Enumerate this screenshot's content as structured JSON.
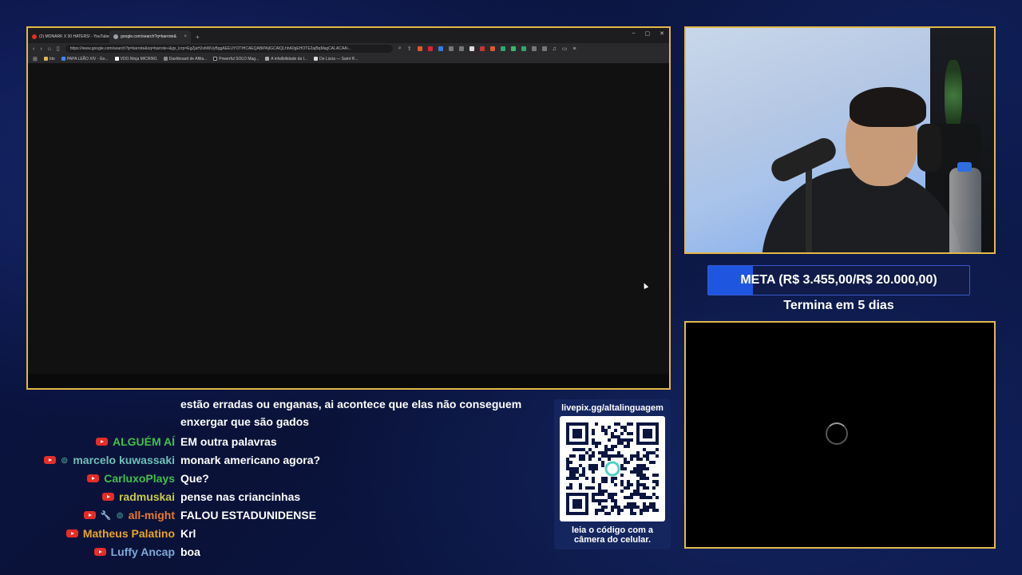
{
  "browser": {
    "tabs": [
      {
        "label": "(2) MONARK X 30 HATERS! - YouTube",
        "favicon_color": "#e52d27",
        "active": false
      },
      {
        "label": "google.com/search?q=barrote&",
        "favicon_color": "#9aa0a6",
        "active": true
      }
    ],
    "new_tab_symbol": "+",
    "window_controls": [
      "–",
      "▢",
      "✕"
    ],
    "url": "https://www.google.com/search?q=barrote&oq=barrote+&gs_lcrp=EgZjaHJvbWUyBggAEEUYOTIHCAEQABiPAjIGCAIQLhhA0gEHOTE2ajBqMagCALACAAi...",
    "bookmarks": [
      {
        "label": "Ide",
        "color": "#e2b84a"
      },
      {
        "label": "PAPA LEÃO XIV - Go...",
        "color": "#e2b84a"
      },
      {
        "label": "VDO.Ninja MICRIM1",
        "color": "#ffffff"
      },
      {
        "label": "Dashboard de Afilia...",
        "color": "#888888"
      },
      {
        "label": "Powerful SOLO Mag...",
        "color": "#e2582a"
      },
      {
        "label": "A infalibilidade da I...",
        "color": "#aaaaaa"
      },
      {
        "label": "De Lúcia — Saint R...",
        "color": "#dddddd"
      }
    ]
  },
  "goal": {
    "text": "META (R$ 3.455,00/R$ 20.000,00)",
    "progress": 0.17275,
    "subtitle": "Termina em 5 dias"
  },
  "chat": {
    "continuation": [
      "estão erradas ou enganas, ai acontece que elas não conseguem",
      "enxergar que são gados"
    ],
    "messages": [
      {
        "user": "ALGUÉM AÍ",
        "color": "#3fbf4a",
        "badges": [],
        "text": "EM outra palavras"
      },
      {
        "user": "marcelo kuwassaki",
        "color": "#6fc0b8",
        "badges": [
          "member"
        ],
        "text": "monark americano agora?"
      },
      {
        "user": "CarluxoPlays",
        "color": "#3fbf4a",
        "badges": [],
        "text": "Que?"
      },
      {
        "user": "radmuskai",
        "color": "#c9c94a",
        "badges": [],
        "text": "pense nas criancinhas"
      },
      {
        "user": "all-might",
        "color": "#e87a2a",
        "badges": [
          "moderator",
          "member"
        ],
        "text": "FALOU ESTADUNIDENSE"
      },
      {
        "user": "Matheus Palatino",
        "color": "#e8a42a",
        "badges": [],
        "text": "Krl"
      },
      {
        "user": "Luffy Ancap",
        "color": "#7fa9d8",
        "badges": [],
        "text": "boa"
      }
    ]
  },
  "qr": {
    "title": "livepix.gg/altalinguagem",
    "caption_line1": "leia o código com a",
    "caption_line2": "câmera do celular."
  },
  "icons": {
    "platform": "youtube-icon",
    "moderator": "wrench-icon",
    "member": "member-badge-icon"
  },
  "colors": {
    "frame_border": "#e2b84a",
    "goal_fill": "#1f56e0",
    "background": "#0b1545"
  }
}
